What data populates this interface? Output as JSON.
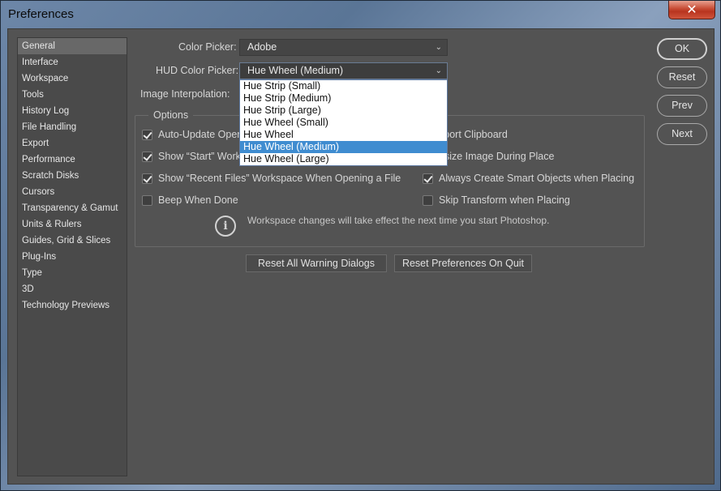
{
  "window": {
    "title": "Preferences",
    "close_label": "✕"
  },
  "sidebar": {
    "items": [
      {
        "label": "General",
        "selected": true
      },
      {
        "label": "Interface"
      },
      {
        "label": "Workspace"
      },
      {
        "label": "Tools"
      },
      {
        "label": "History Log"
      },
      {
        "label": "File Handling"
      },
      {
        "label": "Export"
      },
      {
        "label": "Performance"
      },
      {
        "label": "Scratch Disks"
      },
      {
        "label": "Cursors"
      },
      {
        "label": "Transparency & Gamut"
      },
      {
        "label": "Units & Rulers"
      },
      {
        "label": "Guides, Grid & Slices"
      },
      {
        "label": "Plug-Ins"
      },
      {
        "label": "Type"
      },
      {
        "label": "3D"
      },
      {
        "label": "Technology Previews"
      }
    ]
  },
  "fields": {
    "color_picker_label": "Color Picker:",
    "color_picker_value": "Adobe",
    "hud_label": "HUD Color Picker:",
    "hud_value": "Hue Wheel (Medium)",
    "interp_label": "Image Interpolation:"
  },
  "dropdown": {
    "options": [
      "Hue Strip (Small)",
      "Hue Strip (Medium)",
      "Hue Strip (Large)",
      "Hue Wheel (Small)",
      "Hue Wheel",
      "Hue Wheel (Medium)",
      "Hue Wheel (Large)"
    ],
    "highlighted": "Hue Wheel (Medium)"
  },
  "options": {
    "title": "Options",
    "left": [
      {
        "label": "Auto-Update Oper",
        "checked": true
      },
      {
        "label": "Show “Start” Work",
        "checked": true
      },
      {
        "label": "Show “Recent Files” Workspace When Opening a File",
        "checked": true
      },
      {
        "label": "Beep When Done",
        "checked": false
      }
    ],
    "right": [
      {
        "label": "xport Clipboard",
        "checked": null
      },
      {
        "label": "esize Image During Place",
        "checked": null
      },
      {
        "label": "Always Create Smart Objects when Placing",
        "checked": true
      },
      {
        "label": "Skip Transform when Placing",
        "checked": false
      }
    ],
    "info_text": "Workspace changes will take effect the next time you start Photoshop.",
    "info_icon": "info-icon"
  },
  "buttons": {
    "reset_warnings": "Reset All Warning Dialogs",
    "reset_prefs": "Reset Preferences On Quit",
    "ok": "OK",
    "reset": "Reset",
    "prev": "Prev",
    "next": "Next"
  }
}
